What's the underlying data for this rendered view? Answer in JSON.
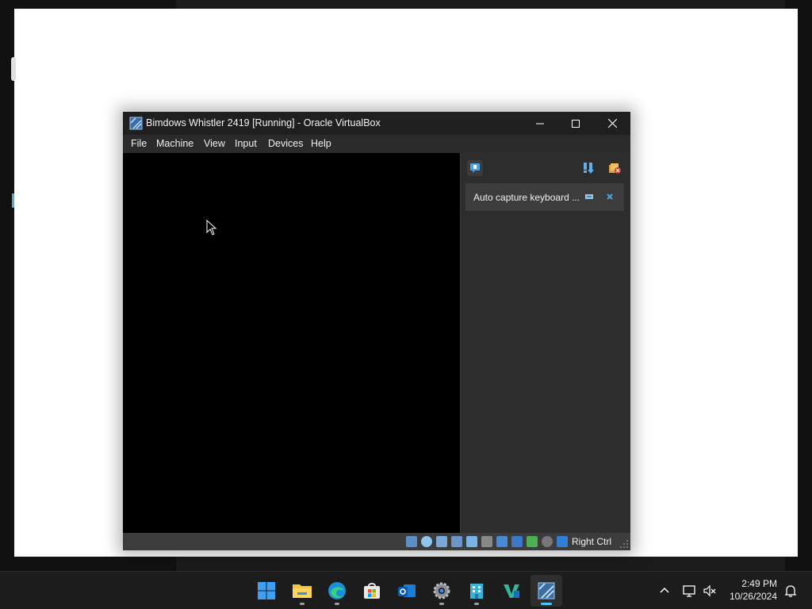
{
  "window": {
    "title": "Bimdows Whistler 2419 [Running] - Oracle VirtualBox",
    "menu": [
      "File",
      "Machine",
      "View",
      "Input",
      "Devices",
      "Help"
    ]
  },
  "notification_center": {
    "message": "Auto capture keyboard ..."
  },
  "statusbar": {
    "host_key": "Right Ctrl",
    "indicators": [
      "hard-disk-icon",
      "optical-drive-icon",
      "audio-icon",
      "network-icon",
      "usb-icon",
      "shared-folders-icon",
      "display-icon",
      "recording-icon",
      "cpu-icon",
      "mouse-integration-icon",
      "keyboard-icon"
    ]
  },
  "taskbar": {
    "apps": [
      "start-button",
      "file-explorer",
      "edge-browser",
      "microsoft-store",
      "outlook",
      "settings",
      "app-building",
      "virtualbox-tool",
      "virtualbox-manager"
    ],
    "time": "2:49 PM",
    "date": "10/26/2024"
  },
  "colors": {
    "accent": "#4cc2ff",
    "titlebar": "#1f1f1f",
    "panel": "#2d2d2d"
  }
}
